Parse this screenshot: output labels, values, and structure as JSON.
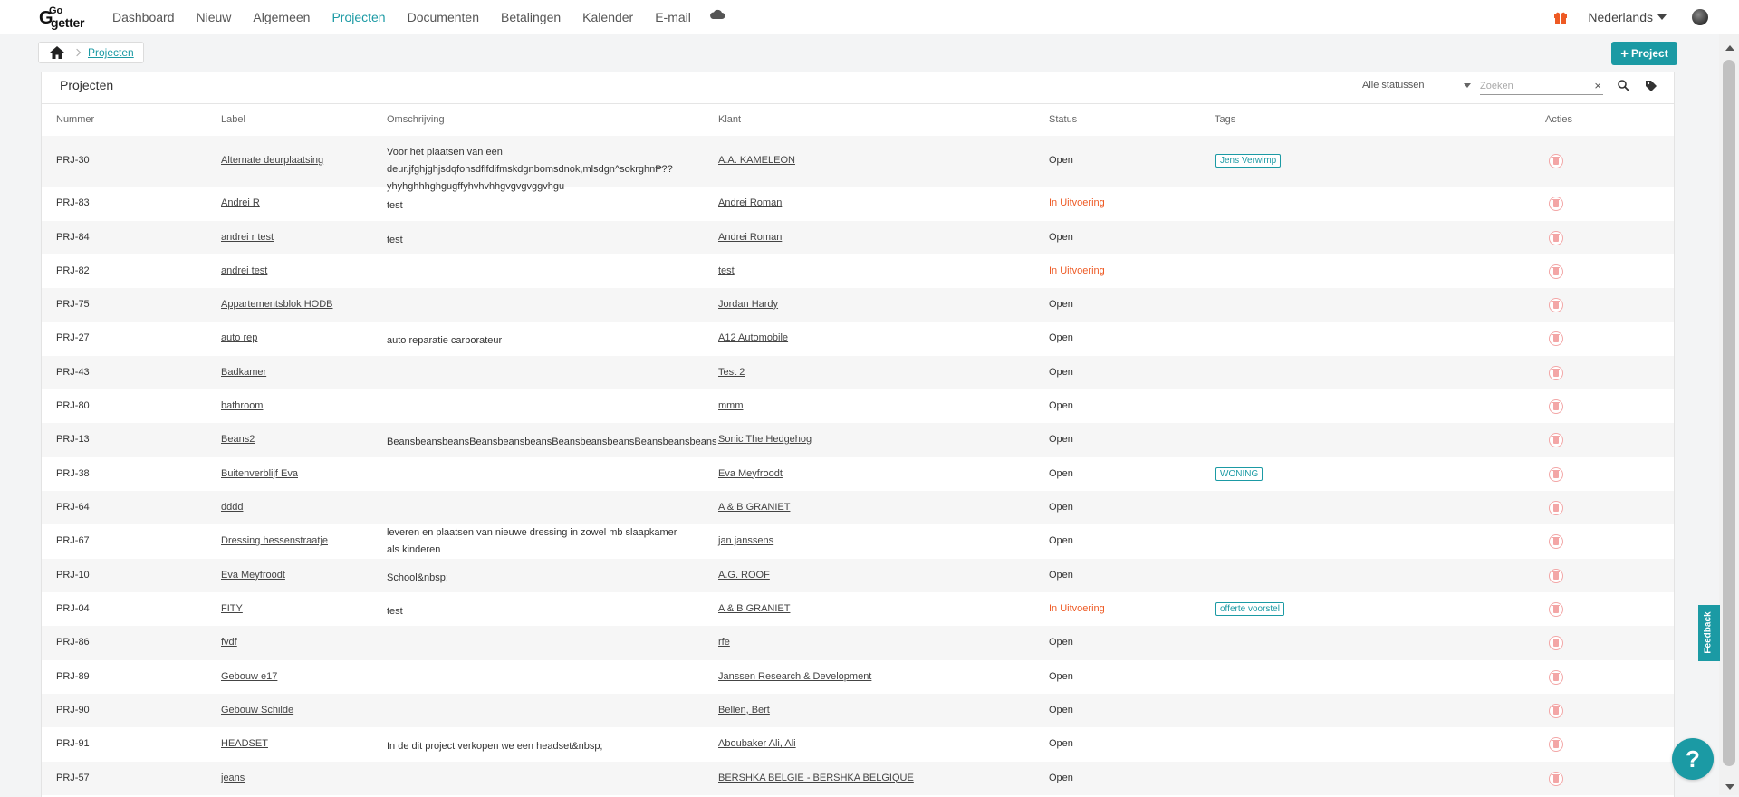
{
  "nav": {
    "logo_top": "Go",
    "logo_bottom": "getter",
    "links": [
      "Dashboard",
      "Nieuw",
      "Algemeen",
      "Projecten",
      "Documenten",
      "Betalingen",
      "Kalender",
      "E-mail"
    ],
    "active_link": "Projecten",
    "language": "Nederlands"
  },
  "breadcrumb": {
    "current": "Projecten"
  },
  "add_button": {
    "label": "Project"
  },
  "card": {
    "title": "Projecten",
    "status_filter": "Alle statussen",
    "search_placeholder": "Zoeken",
    "clear_label": "×"
  },
  "columns": [
    "Nummer",
    "Label",
    "Omschrijving",
    "Klant",
    "Status",
    "Tags",
    "Acties"
  ],
  "rows": [
    {
      "nummer": "PRJ-30",
      "label": "Alternate deurplaatsing",
      "omschrijving": "Voor het plaatsen van een deur.jfghjghjsdqfohsdflfdifmskdgnbomsdnok,mlsdgn^sokrghn₱?? yhyhghhhghgugffyhvhvhhgvgvgvggvhgu",
      "klant": "A.A. KAMELEON",
      "status": "Open",
      "tag": "Jens Verwimp"
    },
    {
      "nummer": "PRJ-83",
      "label": "Andrei R",
      "omschrijving": "test",
      "klant": "Andrei Roman",
      "status": "In Uitvoering",
      "tag": ""
    },
    {
      "nummer": "PRJ-84",
      "label": "andrei r test",
      "omschrijving": "test",
      "klant": "Andrei Roman",
      "status": "Open",
      "tag": ""
    },
    {
      "nummer": "PRJ-82",
      "label": "andrei test",
      "omschrijving": "",
      "klant": "test",
      "status": "In Uitvoering",
      "tag": ""
    },
    {
      "nummer": "PRJ-75",
      "label": "Appartementsblok HODB",
      "omschrijving": "",
      "klant": "Jordan Hardy",
      "status": "Open",
      "tag": ""
    },
    {
      "nummer": "PRJ-27",
      "label": "auto rep",
      "omschrijving": "auto reparatie carborateur",
      "klant": "A12 Automobile",
      "status": "Open",
      "tag": ""
    },
    {
      "nummer": "PRJ-43",
      "label": "Badkamer",
      "omschrijving": "",
      "klant": "Test 2",
      "status": "Open",
      "tag": ""
    },
    {
      "nummer": "PRJ-80",
      "label": "bathroom",
      "omschrijving": "",
      "klant": "mmm",
      "status": "Open",
      "tag": ""
    },
    {
      "nummer": "PRJ-13",
      "label": "Beans2",
      "omschrijving": "BeansbeansbeansBeansbeansbeansBeansbeansbeansBeansbeansbeans",
      "klant": "Sonic The Hedgehog",
      "status": "Open",
      "tag": ""
    },
    {
      "nummer": "PRJ-38",
      "label": "Buitenverblijf Eva",
      "omschrijving": "",
      "klant": "Eva Meyfroodt",
      "status": "Open",
      "tag": "WONING"
    },
    {
      "nummer": "PRJ-64",
      "label": "dddd",
      "omschrijving": "",
      "klant": "A & B GRANIET",
      "status": "Open",
      "tag": ""
    },
    {
      "nummer": "PRJ-67",
      "label": "Dressing hessenstraatje",
      "omschrijving": "leveren en plaatsen van nieuwe dressing in zowel mb slaapkamer als kinderen",
      "klant": "jan janssens",
      "status": "Open",
      "tag": ""
    },
    {
      "nummer": "PRJ-10",
      "label": "Eva Meyfroodt",
      "omschrijving": "School&nbsp;",
      "klant": "A.G. ROOF",
      "status": "Open",
      "tag": ""
    },
    {
      "nummer": "PRJ-04",
      "label": "FITY",
      "omschrijving": "test",
      "klant": "A & B GRANIET",
      "status": "In Uitvoering",
      "tag": "offerte voorstel"
    },
    {
      "nummer": "PRJ-86",
      "label": "fvdf",
      "omschrijving": "",
      "klant": "rfe",
      "status": "Open",
      "tag": ""
    },
    {
      "nummer": "PRJ-89",
      "label": "Gebouw e17",
      "omschrijving": "",
      "klant": "Janssen Research & Development",
      "status": "Open",
      "tag": ""
    },
    {
      "nummer": "PRJ-90",
      "label": "Gebouw Schilde",
      "omschrijving": "",
      "klant": "Bellen, Bert",
      "status": "Open",
      "tag": ""
    },
    {
      "nummer": "PRJ-91",
      "label": "HEADSET",
      "omschrijving": "In de dit project verkopen we een headset&nbsp;",
      "klant": "Aboubaker Ali, Ali",
      "status": "Open",
      "tag": ""
    },
    {
      "nummer": "PRJ-57",
      "label": "jeans",
      "omschrijving": "",
      "klant": "BERSHKA BELGIE - BERSHKA BELGIQUE",
      "status": "Open",
      "tag": ""
    }
  ],
  "feedback_label": "Feedback",
  "help_label": "?",
  "colors": {
    "accent": "#1b9aa4",
    "in_progress": "#ee5a24",
    "trash": "#f3a6a6"
  }
}
